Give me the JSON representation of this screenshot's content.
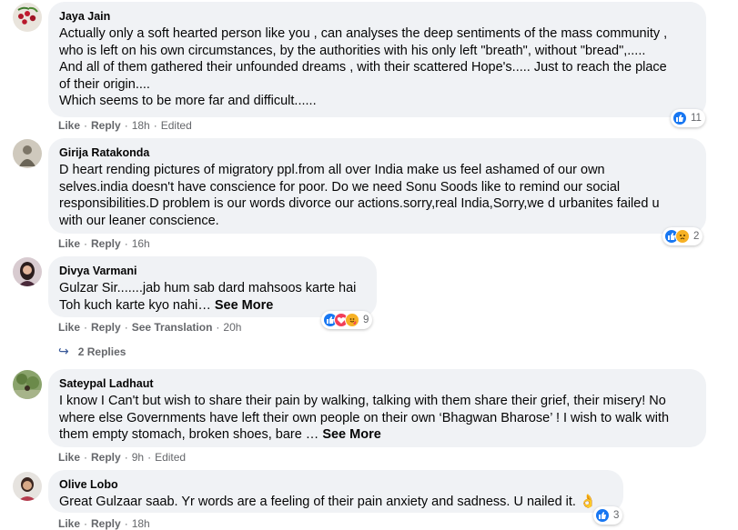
{
  "comments": [
    {
      "author": "Jaya Jain",
      "lines": [
        "Actually only a soft hearted person like you , can analyses the deep sentiments of the mass community ,",
        "who is left on his own circumstances, by the authorities with his only left \"breath\", without \"bread\",.....",
        "And all of them gathered their unfounded dreams , with their scattered Hope's..... Just to reach the place",
        "of their origin....",
        "Which seems to be more far and difficult......"
      ],
      "like": "Like",
      "reply": "Reply",
      "time": "18h",
      "edited": "Edited",
      "reaction_count": "11"
    },
    {
      "author": "Girija Ratakonda",
      "lines": [
        "D heart rending pictures of migratory ppl.from all over India make us feel ashamed of our own",
        "selves.india doesn't have conscience for poor. Do we need Sonu Soods like to remind our social",
        "responsibilities.D problem is our words divorce our actions.sorry,real India,Sorry,we d urbanites failed u",
        "with our leaner conscience."
      ],
      "like": "Like",
      "reply": "Reply",
      "time": "16h",
      "reaction_count": "2"
    },
    {
      "author": "Divya Varmani",
      "lines": [
        "Gulzar Sir.......jab hum sab dard mahsoos karte hai",
        "Toh kuch karte kyo nahi…"
      ],
      "see_more": "See More",
      "like": "Like",
      "reply": "Reply",
      "translation": "See Translation",
      "time": "20h",
      "reaction_count": "9",
      "replies": "2 Replies"
    },
    {
      "author": "Sateypal Ladhaut",
      "lines": [
        "I know I Can't but wish to share their pain by walking, talking with them share their grief, their misery! No",
        "where else Governments have left their own people on their own ‘Bhagwan Bharose’ ! I wish to walk with",
        "them empty stomach, broken shoes, bare …"
      ],
      "see_more": "See More",
      "like": "Like",
      "reply": "Reply",
      "time": "9h",
      "edited": "Edited"
    },
    {
      "author": "Olive Lobo",
      "lines": [
        "Great Gulzaar saab. Yr words are a feeling of their pain anxiety and sadness. U nailed it. 👌"
      ],
      "like": "Like",
      "reply": "Reply",
      "time": "18h",
      "reaction_count": "3"
    }
  ],
  "colors": {
    "bubble": "#f0f2f5",
    "meta": "#65676b",
    "like_blue": "#1877f2",
    "love_red": "#f33e58",
    "haha_yellow": "#f7b125"
  }
}
